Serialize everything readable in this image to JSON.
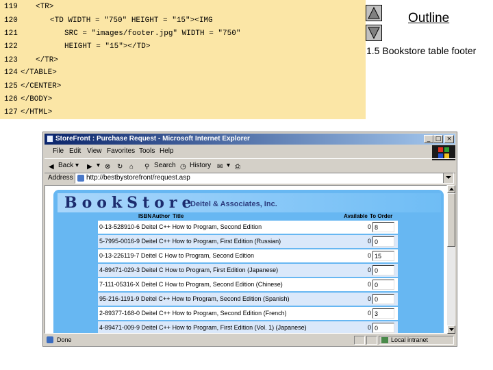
{
  "code": {
    "lines": [
      {
        "num": "119",
        "text": "<TR>"
      },
      {
        "num": "120",
        "text": "<TD WIDTH = \"750\" HEIGHT = \"15\"><IMG"
      },
      {
        "num": "121",
        "text": "SRC = \"images/footer.jpg\" WIDTH = \"750\""
      },
      {
        "num": "122",
        "text": "HEIGHT = \"15\"></TD>"
      },
      {
        "num": "123",
        "text": "</TR>"
      },
      {
        "num": "124",
        "text": "</TABLE>"
      },
      {
        "num": "125",
        "text": "</CENTER>"
      },
      {
        "num": "126",
        "text": "</BODY>"
      },
      {
        "num": "127",
        "text": "</HTML>"
      }
    ]
  },
  "outline": {
    "title": "Outline",
    "caption": "1.5 Bookstore table footer",
    "up_icon": "triangle-up-icon",
    "down_icon": "triangle-down-icon"
  },
  "browser": {
    "title": "StoreFront : Purchase Request - Microsoft Internet Explorer",
    "controls": [
      "_",
      "□",
      "×"
    ],
    "menu": [
      "File",
      "Edit",
      "View",
      "Favorites",
      "Tools",
      "Help"
    ],
    "toolbar": {
      "back": "Back",
      "search": "Search",
      "history": "History"
    },
    "address_label": "Address",
    "address_value": "http://bestbystorefront/request.asp",
    "status_text": "Done",
    "zone_text": "Local intranet"
  },
  "page": {
    "banner_title": "BookStore",
    "banner_subtitle": "Deitel & Associates, Inc.",
    "headers": {
      "isbn": "ISBN",
      "author": "Author",
      "title": "Title",
      "available": "Available",
      "order": "To Order"
    },
    "books": [
      {
        "text": "0-13-528910-6 Deitel C++ How to Program, Second Edition",
        "available": "0",
        "qty": "8"
      },
      {
        "text": "5-7995-0016-9 Deitel C++ How to Program, First Edition (Russian)",
        "available": "0",
        "qty": "0"
      },
      {
        "text": "0-13-226119-7 Deitel C How to Program, Second Edition",
        "available": "0",
        "qty": "15"
      },
      {
        "text": "4-89471-029-3 Deitel C How to Program, First Edition (Japanese)",
        "available": "0",
        "qty": "0"
      },
      {
        "text": "7-111-05316-X Deitel C How to Program, Second Edition (Chinese)",
        "available": "0",
        "qty": "0"
      },
      {
        "text": "95-216-1191-9 Deitel C++ How to Program, Second Edition (Spanish)",
        "available": "0",
        "qty": "0"
      },
      {
        "text": "2-89377-168-0 Deitel C++ How to Program, Second Edition (French)",
        "available": "0",
        "qty": "3"
      },
      {
        "text": "4-89471-009-9 Deitel C++ How to Program, First Edition (Vol. 1) (Japanese)",
        "available": "0",
        "qty": "0"
      }
    ]
  },
  "colors": {
    "code_bg": "#fbe6a6",
    "page_bg": "#67b7f2",
    "banner_text": "#1c2c6e",
    "titlebar_start": "#0a246a"
  }
}
